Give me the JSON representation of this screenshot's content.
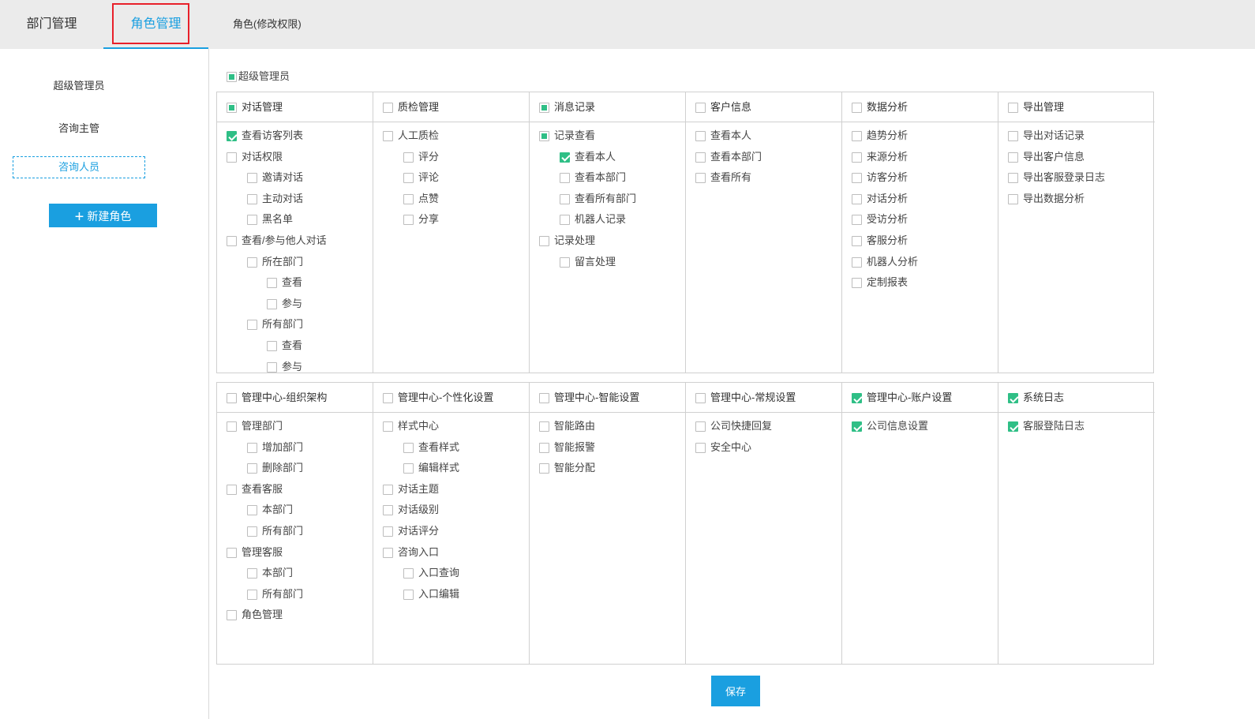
{
  "tabs": {
    "dept": "部门管理",
    "role": "角色管理"
  },
  "panel_title": "角色(修改权限)",
  "sidebar": {
    "roles": [
      "超级管理员",
      "咨询主管",
      "咨询人员"
    ],
    "new_role_label": "新建角色"
  },
  "super_admin_label": "超级管理员",
  "groups1": [
    {
      "title": "对话管理",
      "state": "partial",
      "items": [
        {
          "label": "查看访客列表",
          "level": 0,
          "state": "checked"
        },
        {
          "label": "对话权限",
          "level": 0,
          "state": "none"
        },
        {
          "label": "邀请对话",
          "level": 1,
          "state": "none"
        },
        {
          "label": "主动对话",
          "level": 1,
          "state": "none"
        },
        {
          "label": "黑名单",
          "level": 1,
          "state": "none"
        },
        {
          "label": "查看/参与他人对话",
          "level": 0,
          "state": "none"
        },
        {
          "label": "所在部门",
          "level": 1,
          "state": "none"
        },
        {
          "label": "查看",
          "level": 2,
          "state": "none"
        },
        {
          "label": "参与",
          "level": 2,
          "state": "none"
        },
        {
          "label": "所有部门",
          "level": 1,
          "state": "none"
        },
        {
          "label": "查看",
          "level": 2,
          "state": "none"
        },
        {
          "label": "参与",
          "level": 2,
          "state": "none"
        }
      ]
    },
    {
      "title": "质检管理",
      "state": "none",
      "items": [
        {
          "label": "人工质检",
          "level": 0,
          "state": "none"
        },
        {
          "label": "评分",
          "level": 1,
          "state": "none"
        },
        {
          "label": "评论",
          "level": 1,
          "state": "none"
        },
        {
          "label": "点赞",
          "level": 1,
          "state": "none"
        },
        {
          "label": "分享",
          "level": 1,
          "state": "none"
        }
      ]
    },
    {
      "title": "消息记录",
      "state": "partial",
      "items": [
        {
          "label": "记录查看",
          "level": 0,
          "state": "partial"
        },
        {
          "label": "查看本人",
          "level": 1,
          "state": "checked"
        },
        {
          "label": "查看本部门",
          "level": 1,
          "state": "none"
        },
        {
          "label": "查看所有部门",
          "level": 1,
          "state": "none"
        },
        {
          "label": "机器人记录",
          "level": 1,
          "state": "none"
        },
        {
          "label": "记录处理",
          "level": 0,
          "state": "none"
        },
        {
          "label": "留言处理",
          "level": 1,
          "state": "none"
        }
      ]
    },
    {
      "title": "客户信息",
      "state": "none",
      "items": [
        {
          "label": "查看本人",
          "level": 0,
          "state": "none"
        },
        {
          "label": "查看本部门",
          "level": 0,
          "state": "none"
        },
        {
          "label": "查看所有",
          "level": 0,
          "state": "none"
        }
      ]
    },
    {
      "title": "数据分析",
      "state": "none",
      "items": [
        {
          "label": "趋势分析",
          "level": 0,
          "state": "none"
        },
        {
          "label": "来源分析",
          "level": 0,
          "state": "none"
        },
        {
          "label": "访客分析",
          "level": 0,
          "state": "none"
        },
        {
          "label": "对话分析",
          "level": 0,
          "state": "none"
        },
        {
          "label": "受访分析",
          "level": 0,
          "state": "none"
        },
        {
          "label": "客服分析",
          "level": 0,
          "state": "none"
        },
        {
          "label": "机器人分析",
          "level": 0,
          "state": "none"
        },
        {
          "label": "定制报表",
          "level": 0,
          "state": "none"
        }
      ]
    },
    {
      "title": "导出管理",
      "state": "none",
      "items": [
        {
          "label": "导出对话记录",
          "level": 0,
          "state": "none"
        },
        {
          "label": "导出客户信息",
          "level": 0,
          "state": "none"
        },
        {
          "label": "导出客服登录日志",
          "level": 0,
          "state": "none"
        },
        {
          "label": "导出数据分析",
          "level": 0,
          "state": "none"
        }
      ]
    }
  ],
  "groups2": [
    {
      "title": "管理中心-组织架构",
      "state": "none",
      "items": [
        {
          "label": "管理部门",
          "level": 0,
          "state": "none"
        },
        {
          "label": "增加部门",
          "level": 1,
          "state": "none"
        },
        {
          "label": "删除部门",
          "level": 1,
          "state": "none"
        },
        {
          "label": "查看客服",
          "level": 0,
          "state": "none"
        },
        {
          "label": "本部门",
          "level": 1,
          "state": "none"
        },
        {
          "label": "所有部门",
          "level": 1,
          "state": "none"
        },
        {
          "label": "管理客服",
          "level": 0,
          "state": "none"
        },
        {
          "label": "本部门",
          "level": 1,
          "state": "none"
        },
        {
          "label": "所有部门",
          "level": 1,
          "state": "none"
        },
        {
          "label": "角色管理",
          "level": 0,
          "state": "none"
        }
      ]
    },
    {
      "title": "管理中心-个性化设置",
      "state": "none",
      "items": [
        {
          "label": "样式中心",
          "level": 0,
          "state": "none"
        },
        {
          "label": "查看样式",
          "level": 1,
          "state": "none"
        },
        {
          "label": "编辑样式",
          "level": 1,
          "state": "none"
        },
        {
          "label": "对话主题",
          "level": 0,
          "state": "none"
        },
        {
          "label": "对话级别",
          "level": 0,
          "state": "none"
        },
        {
          "label": "对话评分",
          "level": 0,
          "state": "none"
        },
        {
          "label": "咨询入口",
          "level": 0,
          "state": "none"
        },
        {
          "label": "入口查询",
          "level": 1,
          "state": "none"
        },
        {
          "label": "入口编辑",
          "level": 1,
          "state": "none"
        }
      ]
    },
    {
      "title": "管理中心-智能设置",
      "state": "none",
      "items": [
        {
          "label": "智能路由",
          "level": 0,
          "state": "none"
        },
        {
          "label": "智能报警",
          "level": 0,
          "state": "none"
        },
        {
          "label": "智能分配",
          "level": 0,
          "state": "none"
        }
      ]
    },
    {
      "title": "管理中心-常规设置",
      "state": "none",
      "items": [
        {
          "label": "公司快捷回复",
          "level": 0,
          "state": "none"
        },
        {
          "label": "安全中心",
          "level": 0,
          "state": "none"
        }
      ]
    },
    {
      "title": "管理中心-账户设置",
      "state": "checked",
      "items": [
        {
          "label": "公司信息设置",
          "level": 0,
          "state": "checked"
        }
      ]
    },
    {
      "title": "系统日志",
      "state": "checked",
      "items": [
        {
          "label": "客服登陆日志",
          "level": 0,
          "state": "checked"
        }
      ]
    }
  ],
  "save_label": "保存",
  "colors": {
    "accent": "#1a9fe0",
    "check": "#2fbf86",
    "highlight": "#e8202a"
  }
}
